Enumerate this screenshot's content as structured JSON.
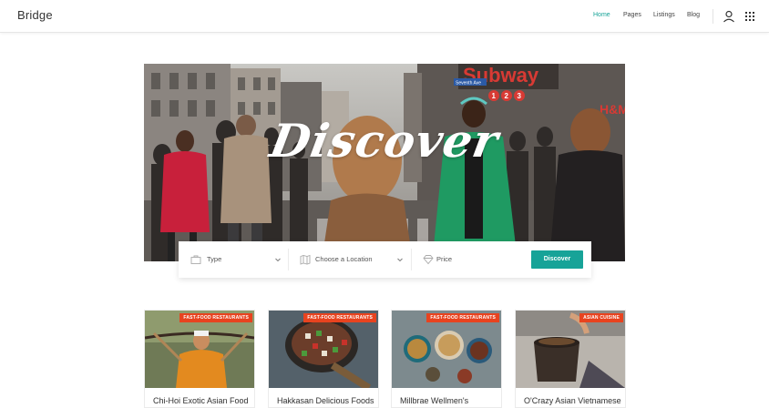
{
  "header": {
    "brand": "Bridge",
    "nav": [
      {
        "label": "Home",
        "active": true
      },
      {
        "label": "Pages",
        "active": false
      },
      {
        "label": "Listings",
        "active": false
      },
      {
        "label": "Blog",
        "active": false
      }
    ],
    "icons": [
      "user-icon",
      "grid-menu-icon"
    ]
  },
  "hero": {
    "title": "Discover",
    "signage": {
      "subway_text": "Subway",
      "lines": [
        "1",
        "2",
        "3"
      ],
      "street_sign": "Seventh Ave",
      "store": "H&M"
    }
  },
  "search": {
    "type_placeholder": "Type",
    "location_placeholder": "Choose a Location",
    "price_placeholder": "Price",
    "button_label": "Discover"
  },
  "cards": [
    {
      "badge": "FAST-FOOD RESTAURANTS",
      "title": "Chi-Hoi Exotic Asian Food"
    },
    {
      "badge": "FAST-FOOD RESTAURANTS",
      "title": "Hakkasan Delicious Foods"
    },
    {
      "badge": "FAST-FOOD RESTAURANTS",
      "title": "Millbrae Wellmen's"
    },
    {
      "badge": "ASIAN CUISINE",
      "title": "O'Crazy Asian Vietnamese"
    }
  ],
  "colors": {
    "accent": "#17a398",
    "badge": "#e8431f",
    "text": "#303030"
  }
}
